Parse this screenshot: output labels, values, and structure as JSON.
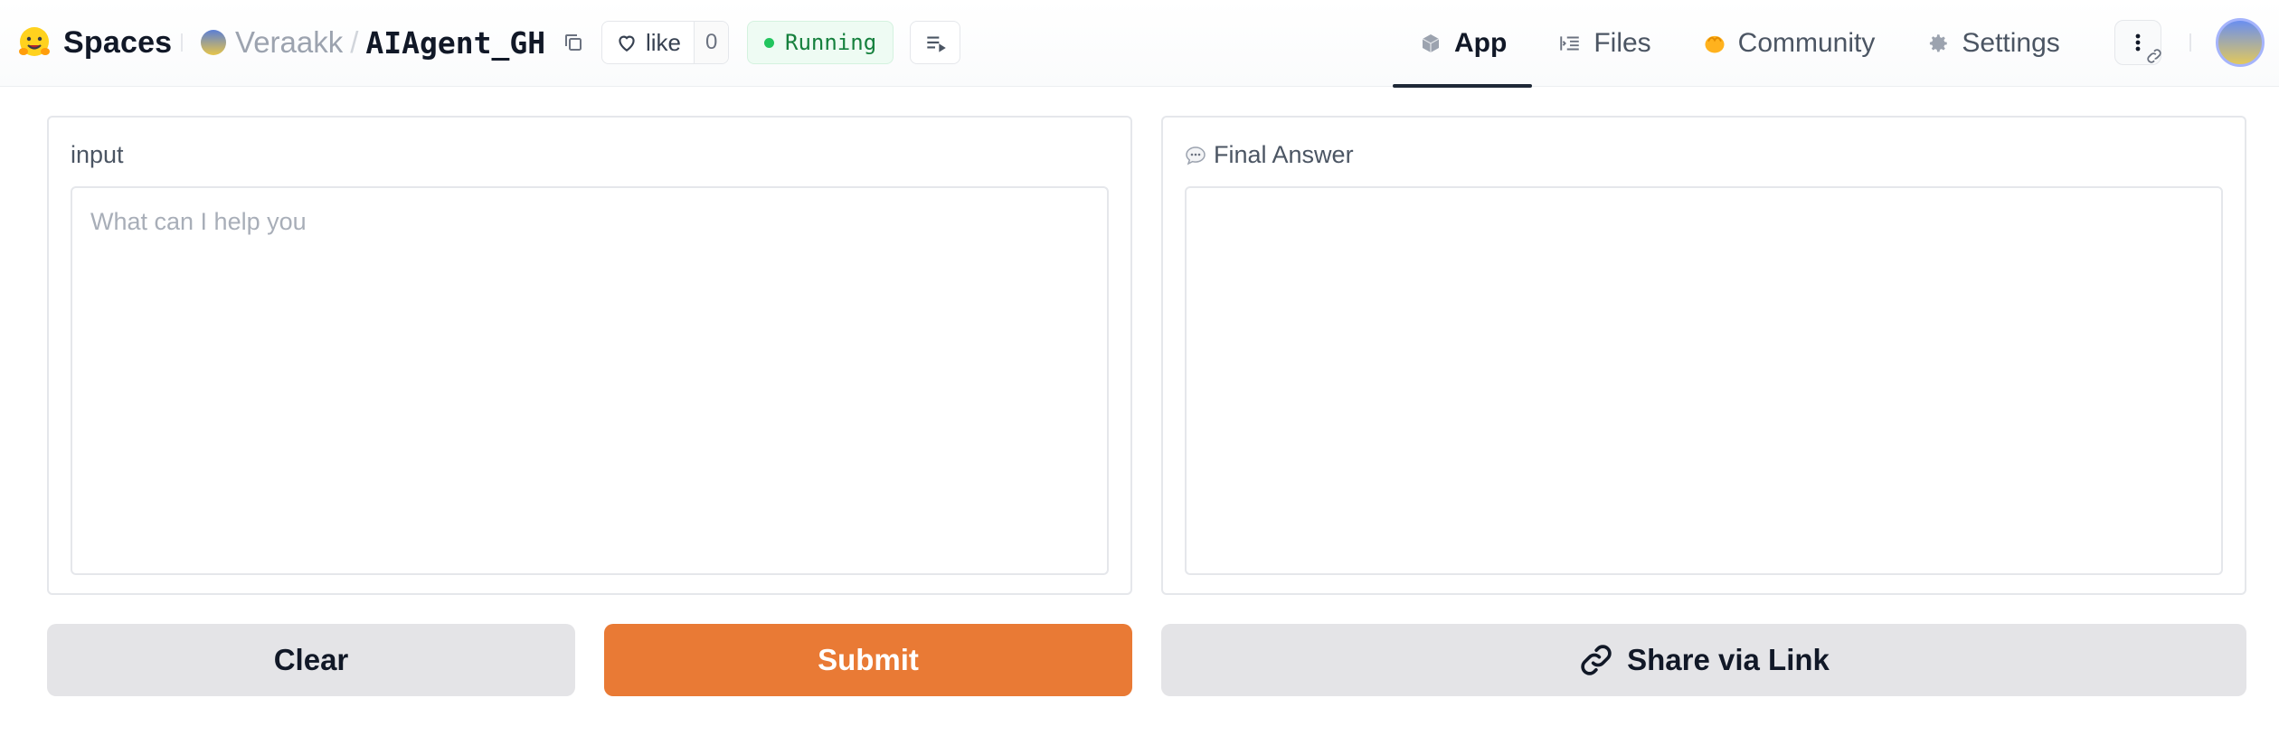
{
  "header": {
    "brand": "Spaces",
    "owner": "Veraakk",
    "separator": "/",
    "repo": "AIAgent_GH",
    "like_label": "like",
    "like_count": "0",
    "status": "Running",
    "status_color": "#22c55e",
    "tabs": [
      {
        "label": "App",
        "icon": "cube-icon",
        "active": true
      },
      {
        "label": "Files",
        "icon": "files-icon",
        "active": false
      },
      {
        "label": "Community",
        "icon": "community-icon",
        "active": false
      },
      {
        "label": "Settings",
        "icon": "gear-icon",
        "active": false
      }
    ]
  },
  "input_panel": {
    "label": "input",
    "placeholder": "What can I help you",
    "value": ""
  },
  "output_panel": {
    "label": "Final Answer",
    "icon": "speech-bubble-icon",
    "value": ""
  },
  "buttons": {
    "clear": "Clear",
    "submit": "Submit",
    "share": "Share via Link"
  },
  "colors": {
    "accent": "#e97a35",
    "secondary_button": "#e4e4e7"
  }
}
